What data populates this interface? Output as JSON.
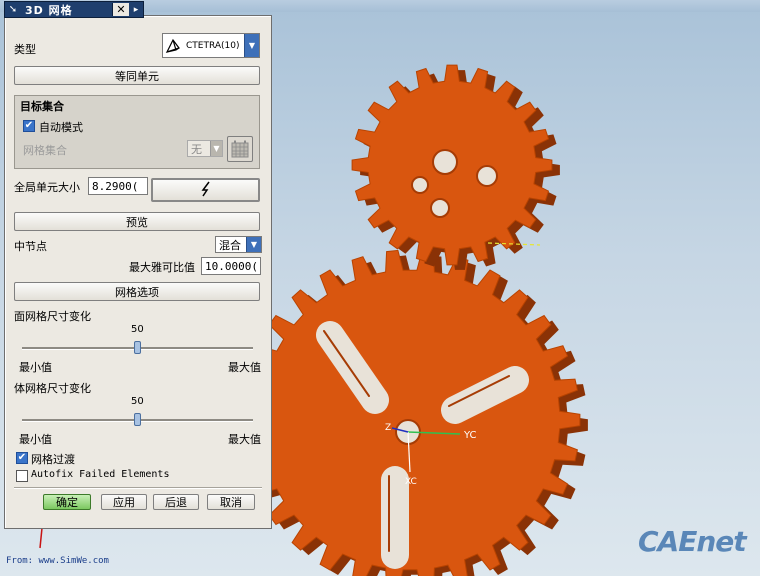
{
  "dialog": {
    "title": "3D 网格",
    "close_glyph": "✕",
    "type_label": "类型",
    "type_value": "CTETRA(10)",
    "equal_button": "等同单元",
    "target_group_title": "目标集合",
    "auto_mode_label": "自动模式",
    "auto_mode_checked": true,
    "mesh_collector_label": "网格集合",
    "mesh_collector_value": "无",
    "global_size_label": "全局单元大小",
    "global_size_value": "8.2900(",
    "preview_button": "预览",
    "mid_node_label": "中节点",
    "mid_node_value": "混合",
    "max_jacobian_label": "最大雅可比值",
    "max_jacobian_value": "10.0000(",
    "mesh_options_button": "网格选项",
    "surface_size_label": "面网格尺寸变化",
    "surface_slider_value": "50",
    "surface_min": "最小值",
    "surface_max": "最大值",
    "volume_size_label": "体网格尺寸变化",
    "volume_slider_value": "50",
    "volume_min": "最小值",
    "volume_max": "最大值",
    "mesh_transition_label": "网格过渡",
    "mesh_transition_checked": true,
    "autofix_label": "Autofix Failed Elements",
    "autofix_checked": false,
    "ok_button": "确定",
    "apply_button": "应用",
    "back_button": "后退",
    "cancel_button": "取消"
  },
  "viewport": {
    "axis_yc": "YC",
    "axis_xc": "XC",
    "axis_z": "Z",
    "gear_color": "#d9560f"
  },
  "watermark": {
    "brand": "CAEnet",
    "from": "From: www.SimWe.com"
  },
  "icons": {
    "pin": "pin-icon",
    "tetra": "tetra-mesh-icon",
    "lightning": "lightning-icon",
    "grid": "grid-select-icon"
  }
}
